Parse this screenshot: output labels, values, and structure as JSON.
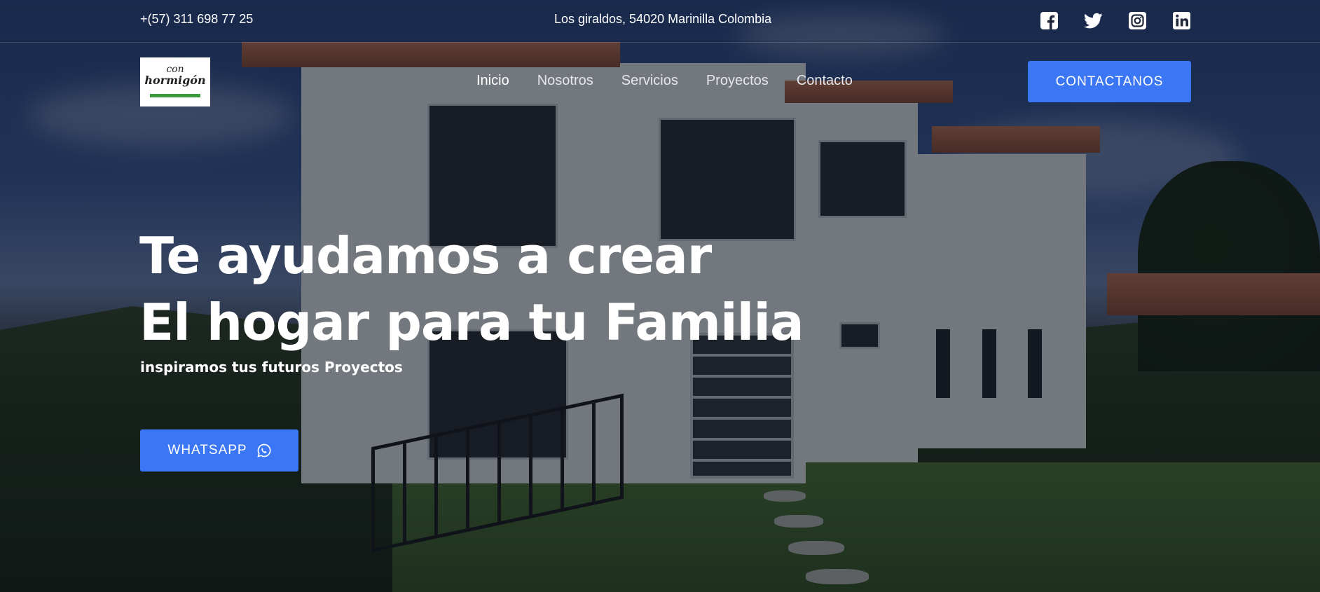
{
  "topbar": {
    "phone": "+(57) 311 698 77 25",
    "address": "Los giraldos, 54020 Marinilla Colombia",
    "socials": [
      "facebook-icon",
      "twitter-icon",
      "instagram-icon",
      "linkedin-icon"
    ]
  },
  "logo": {
    "line1": "con",
    "line2": "hormigón"
  },
  "nav": {
    "items": [
      "Inicio",
      "Nosotros",
      "Servicios",
      "Proyectos",
      "Contacto"
    ],
    "active": "Inicio"
  },
  "contact_button": "CONTACTANOS",
  "hero": {
    "title_line1": "Te ayudamos a crear",
    "title_line2": "El hogar para tu Familia",
    "subtitle": "inspiramos tus futuros Proyectos",
    "whatsapp_label": "WHATSAPP"
  },
  "colors": {
    "accent": "#3b76f5",
    "overlay": "#080c16",
    "logo_bar": "#3c9a3c"
  }
}
